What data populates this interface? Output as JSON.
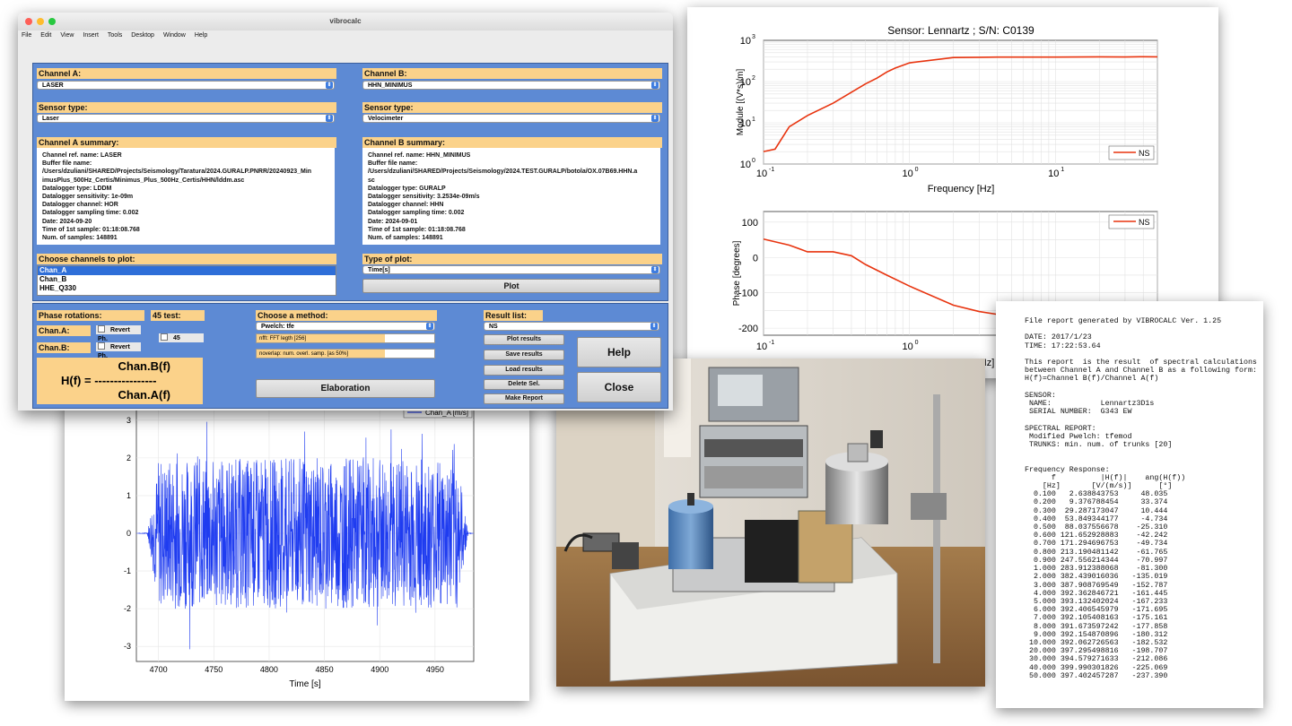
{
  "app": {
    "title": "vibrocalc",
    "menu": [
      "File",
      "Edit",
      "View",
      "Insert",
      "Tools",
      "Desktop",
      "Window",
      "Help"
    ],
    "channel_a": {
      "label": "Channel A:",
      "value": "LASER"
    },
    "channel_b": {
      "label": "Channel B:",
      "value": "HHN_MINIMUS"
    },
    "sensor_a": {
      "label": "Sensor type:",
      "value": "Laser"
    },
    "sensor_b": {
      "label": "Sensor type:",
      "value": "Velocimeter"
    },
    "summary_a": {
      "label": "Channel A summary:",
      "lines": [
        "Channel ref. name: LASER",
        "Buffer file name:",
        "/Users/dzuliani/SHARED/Projects/Seismology/Taratura/2024.GURALP.PNRR/20240923_Min",
        "imusPlus_500Hz_Certis/Minimus_Plus_500Hz_Certis/HHN/lddm.asc",
        "Datalogger type: LDDM",
        "Datalogger sensitivity: 1e-09m",
        "Datalogger channel: HOR",
        "Datalogger sampling time: 0.002",
        "Date: 2024-09-20",
        "Time of 1st sample: 01:18:08.768",
        "Num. of samples: 148891"
      ]
    },
    "summary_b": {
      "label": "Channel B summary:",
      "lines": [
        "Channel ref. name: HHN_MINIMUS",
        "Buffer file name:",
        "/Users/dzuliani/SHARED/Projects/Seismology/2024.TEST.GURALP/botola/OX.07B69.HHN.a",
        "sc",
        "Datalogger type: GURALP",
        "Datalogger sensitivity: 3.2534e-09m/s",
        "Datalogger channel: HHN",
        "Datalogger sampling time: 0.002",
        "Date: 2024-09-01",
        "Time of 1st sample: 01:18:08.768",
        "Num. of samples: 148891"
      ]
    },
    "channels_to_plot": {
      "label": "Choose channels to plot:",
      "items": [
        "Chan_A",
        "Chan_B",
        "HHE_Q330"
      ],
      "selected": 0
    },
    "type_of_plot": {
      "label": "Type of plot:",
      "value": "Time[s]"
    },
    "plot_button": "Plot",
    "phase_rotations": {
      "label": "Phase rotations:",
      "chan_a": "Chan.A:",
      "chan_b": "Chan.B:",
      "revert": "Revert Ph."
    },
    "test45": {
      "label": "45 test:",
      "value": "45"
    },
    "formula": {
      "num": "Chan.B(f)",
      "lhs": "H(f) = ----------------",
      "den": "Chan.A(f)"
    },
    "method": {
      "label": "Choose a method:",
      "value": "Pwelch: tfe",
      "nfft": "nfft: FFT legth [256]",
      "noverlap": "noverlap: num. overl. samp. [as 50%]"
    },
    "elaboration_button": "Elaboration",
    "result_list": {
      "label": "Result list:",
      "value": "NS"
    },
    "buttons": [
      "Plot results",
      "Save results",
      "Load results",
      "Delete Sel.",
      "Make Report"
    ],
    "help_button": "Help",
    "close_button": "Close"
  },
  "bode_chart": {
    "title": "Sensor: Lennartz ; S/N: C0139",
    "module_ylabel": "Module [(V*s)/m]",
    "phase_ylabel": "Phase [degrees]",
    "xlabel": "Frequency [Hz]",
    "legend": "NS",
    "xticks": [
      "10",
      "10",
      "10"
    ],
    "xtick_exp": [
      "-1",
      "0",
      "1"
    ],
    "yticks_module": [
      "10",
      "10",
      "10",
      "10"
    ],
    "ytick_module_exp": [
      "0",
      "1",
      "2",
      "3"
    ],
    "yticks_phase": [
      "100",
      "0",
      "-100",
      "-200"
    ]
  },
  "chart_data": [
    {
      "type": "line",
      "title": "Sensor: Lennartz ; S/N: C0139",
      "xlabel": "Frequency [Hz]",
      "ylabel": "Module [(V*s)/m]",
      "xscale": "log",
      "yscale": "log",
      "xlim": [
        0.1,
        50
      ],
      "ylim": [
        1,
        1000
      ],
      "legend_position": "bottom-right",
      "grid": true,
      "series": [
        {
          "name": "NS",
          "x": [
            0.1,
            0.12,
            0.15,
            0.2,
            0.3,
            0.4,
            0.5,
            0.6,
            0.7,
            0.8,
            0.9,
            1,
            2,
            3,
            4,
            5,
            10,
            20,
            30,
            40,
            50
          ],
          "y": [
            2,
            2.3,
            8,
            15,
            30,
            55,
            88,
            122,
            171,
            213,
            248,
            284,
            382,
            388,
            392,
            393,
            392,
            397,
            395,
            400,
            397
          ]
        }
      ]
    },
    {
      "type": "line",
      "xlabel": "Frequency [Hz]",
      "ylabel": "Phase [degrees]",
      "xscale": "log",
      "xlim": [
        0.1,
        50
      ],
      "ylim": [
        -220,
        130
      ],
      "legend_position": "top-right",
      "grid": true,
      "series": [
        {
          "name": "NS",
          "x": [
            0.1,
            0.15,
            0.2,
            0.3,
            0.4,
            0.5,
            0.7,
            1,
            2,
            3,
            4,
            5
          ],
          "y": [
            52,
            35,
            16,
            16,
            5,
            -20,
            -50,
            -81,
            -135,
            -153,
            -161,
            -167
          ]
        }
      ]
    },
    {
      "type": "line",
      "xlabel": "Time [s]",
      "xlim": [
        4680,
        4985
      ],
      "ylim": [
        -3.4,
        3.4
      ],
      "legend": "Chan_A [m/s]",
      "xticks": [
        4700,
        4750,
        4800,
        4850,
        4900,
        4950
      ],
      "yticks": [
        3,
        2,
        1,
        0,
        -1,
        -2,
        -3
      ],
      "series": [
        {
          "name": "Chan_A [m/s]",
          "x": [
            4680,
            4690,
            4700,
            4970,
            4980,
            4985
          ],
          "y": [
            0,
            0.02,
            2.0,
            2.0,
            0.02,
            0
          ]
        }
      ]
    }
  ],
  "report": {
    "lines": [
      "File report generated by VIBROCALC Ver. 1.25",
      "",
      "DATE: 2017/1/23",
      "TIME: 17:22:53.64",
      "",
      "This report  is the result  of spectral calculations",
      "between Channel A and Channel B as a following form:",
      "H(f)=Channel B(f)/Channel A(f)",
      "",
      "SENSOR:",
      " NAME:           Lennartz3D1s",
      " SERIAL NUMBER:  G343 EW",
      "",
      "SPECTRAL REPORT:",
      " Modified Pwelch: tfemod",
      " TRUNKS: min. num. of trunks [20]",
      "",
      "",
      "Frequency Response:",
      "      f          |H(f)|    ang(H(f))",
      "    [Hz]       [V/(m/s)]      [°]",
      "  0.100   2.638843753     48.035",
      "  0.200   9.376788454     33.374",
      "  0.300  29.287173047     10.444",
      "  0.400  53.849344177     -4.734",
      "  0.500  88.037556678    -25.310",
      "  0.600 121.652928883    -42.242",
      "  0.700 171.294696753    -49.734",
      "  0.800 213.190481142    -61.765",
      "  0.900 247.556214344    -70.997",
      "  1.000 283.912388068    -81.300",
      "  2.000 382.439016036   -135.019",
      "  3.000 387.908769549   -152.787",
      "  4.000 392.362846721   -161.445",
      "  5.000 393.132402024   -167.233",
      "  6.000 392.406545979   -171.695",
      "  7.000 392.105408163   -175.161",
      "  8.000 391.673597242   -177.858",
      "  9.000 392.154870896   -180.312",
      " 10.000 392.062726563   -182.532",
      " 20.000 397.295498816   -198.707",
      " 30.000 394.579271633   -212.086",
      " 40.000 399.990301826   -225.069",
      " 50.000 397.402457287   -237.390"
    ]
  },
  "colors": {
    "panel": "#5d8ad4",
    "header": "#fbd28a",
    "curve": "#e8340f",
    "signal": "#1f3cf0"
  }
}
